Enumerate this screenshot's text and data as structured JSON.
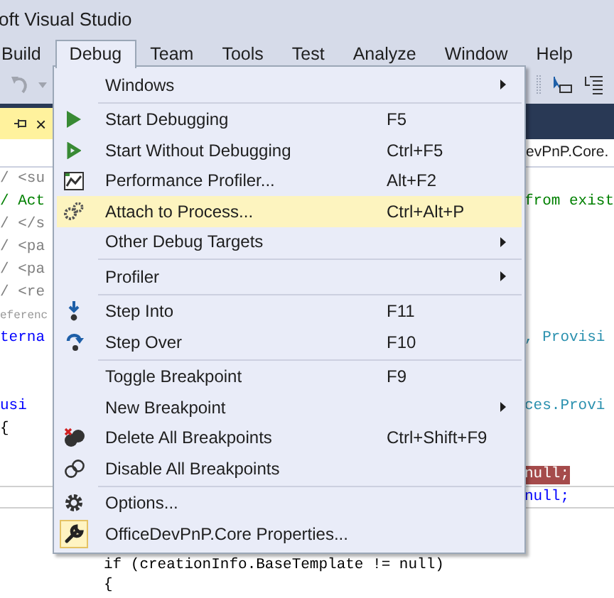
{
  "window": {
    "title": "oft Visual Studio"
  },
  "menu_bar": [
    {
      "label": "Build",
      "selected": false
    },
    {
      "label": "Debug",
      "selected": true
    },
    {
      "label": "Team",
      "selected": false
    },
    {
      "label": "Tools",
      "selected": false
    },
    {
      "label": "Test",
      "selected": false
    },
    {
      "label": "Analyze",
      "selected": false
    },
    {
      "label": "Window",
      "selected": false
    },
    {
      "label": "Help",
      "selected": false
    }
  ],
  "document_tab": {
    "close": "×"
  },
  "nav_bar": {
    "text": "evPnP.Core."
  },
  "code_lines": [
    {
      "left": {
        "text": "/ <su",
        "kind": "doc"
      }
    },
    {
      "left": {
        "text": "/ Act",
        "kind": "comment"
      },
      "right": {
        "text": "from exist",
        "kind": "comment"
      }
    },
    {
      "left": {
        "text": "/ </s",
        "kind": "doc"
      }
    },
    {
      "left": {
        "text": "/ <pa",
        "kind": "doc"
      }
    },
    {
      "left": {
        "text": "/ <pa",
        "kind": "doc"
      }
    },
    {
      "left": {
        "text": "/ <re",
        "kind": "doc"
      }
    },
    {
      "left": {
        "text": "eferenc",
        "kind": "codelens"
      }
    },
    {
      "left": {
        "text": "terna",
        "kind": "keyword"
      },
      "right": {
        "text": ", Provisi",
        "kind": "type"
      }
    },
    {
      "left": {
        "text": "usi",
        "kind": "keyword"
      },
      "right": {
        "text": "ces.Provi",
        "kind": "type"
      }
    },
    {
      "left": {
        "text": "{",
        "kind": "code"
      }
    },
    {
      "right": {
        "text": "null;",
        "kind": "breakpoint"
      }
    },
    {
      "current": true,
      "right": {
        "text": "null;",
        "kind": "keyword"
      }
    },
    {
      "center": {
        "text": "if (creationInfo.BaseTemplate != null)",
        "kind": "code"
      }
    },
    {
      "center": {
        "text": "{",
        "kind": "code"
      }
    }
  ],
  "menu": {
    "items": [
      {
        "kind": "item",
        "label": "Windows",
        "submenu": true,
        "highlighted": false
      },
      {
        "kind": "separator"
      },
      {
        "kind": "item",
        "label": "Start Debugging",
        "shortcut": "F5",
        "highlighted": false
      },
      {
        "kind": "item",
        "label": "Start Without Debugging",
        "shortcut": "Ctrl+F5",
        "highlighted": false
      },
      {
        "kind": "item",
        "label": "Performance Profiler...",
        "shortcut": "Alt+F2",
        "highlighted": false
      },
      {
        "kind": "item",
        "label": "Attach to Process...",
        "shortcut": "Ctrl+Alt+P",
        "highlighted": true
      },
      {
        "kind": "item",
        "label": "Other Debug Targets",
        "submenu": true,
        "highlighted": false
      },
      {
        "kind": "separator"
      },
      {
        "kind": "item",
        "label": "Profiler",
        "submenu": true,
        "highlighted": false
      },
      {
        "kind": "separator"
      },
      {
        "kind": "item",
        "label": "Step Into",
        "shortcut": "F11",
        "highlighted": false
      },
      {
        "kind": "item",
        "label": "Step Over",
        "shortcut": "F10",
        "highlighted": false
      },
      {
        "kind": "separator"
      },
      {
        "kind": "item",
        "label": "Toggle Breakpoint",
        "shortcut": "F9",
        "highlighted": false
      },
      {
        "kind": "item",
        "label": "New Breakpoint",
        "submenu": true,
        "highlighted": false
      },
      {
        "kind": "item",
        "label": "Delete All Breakpoints",
        "shortcut": "Ctrl+Shift+F9",
        "highlighted": false
      },
      {
        "kind": "item",
        "label": "Disable All Breakpoints",
        "highlighted": false
      },
      {
        "kind": "separator"
      },
      {
        "kind": "item",
        "label": "Options...",
        "highlighted": false
      },
      {
        "kind": "item",
        "label": "OfficeDevPnP.Core Properties...",
        "highlighted": false
      }
    ]
  }
}
